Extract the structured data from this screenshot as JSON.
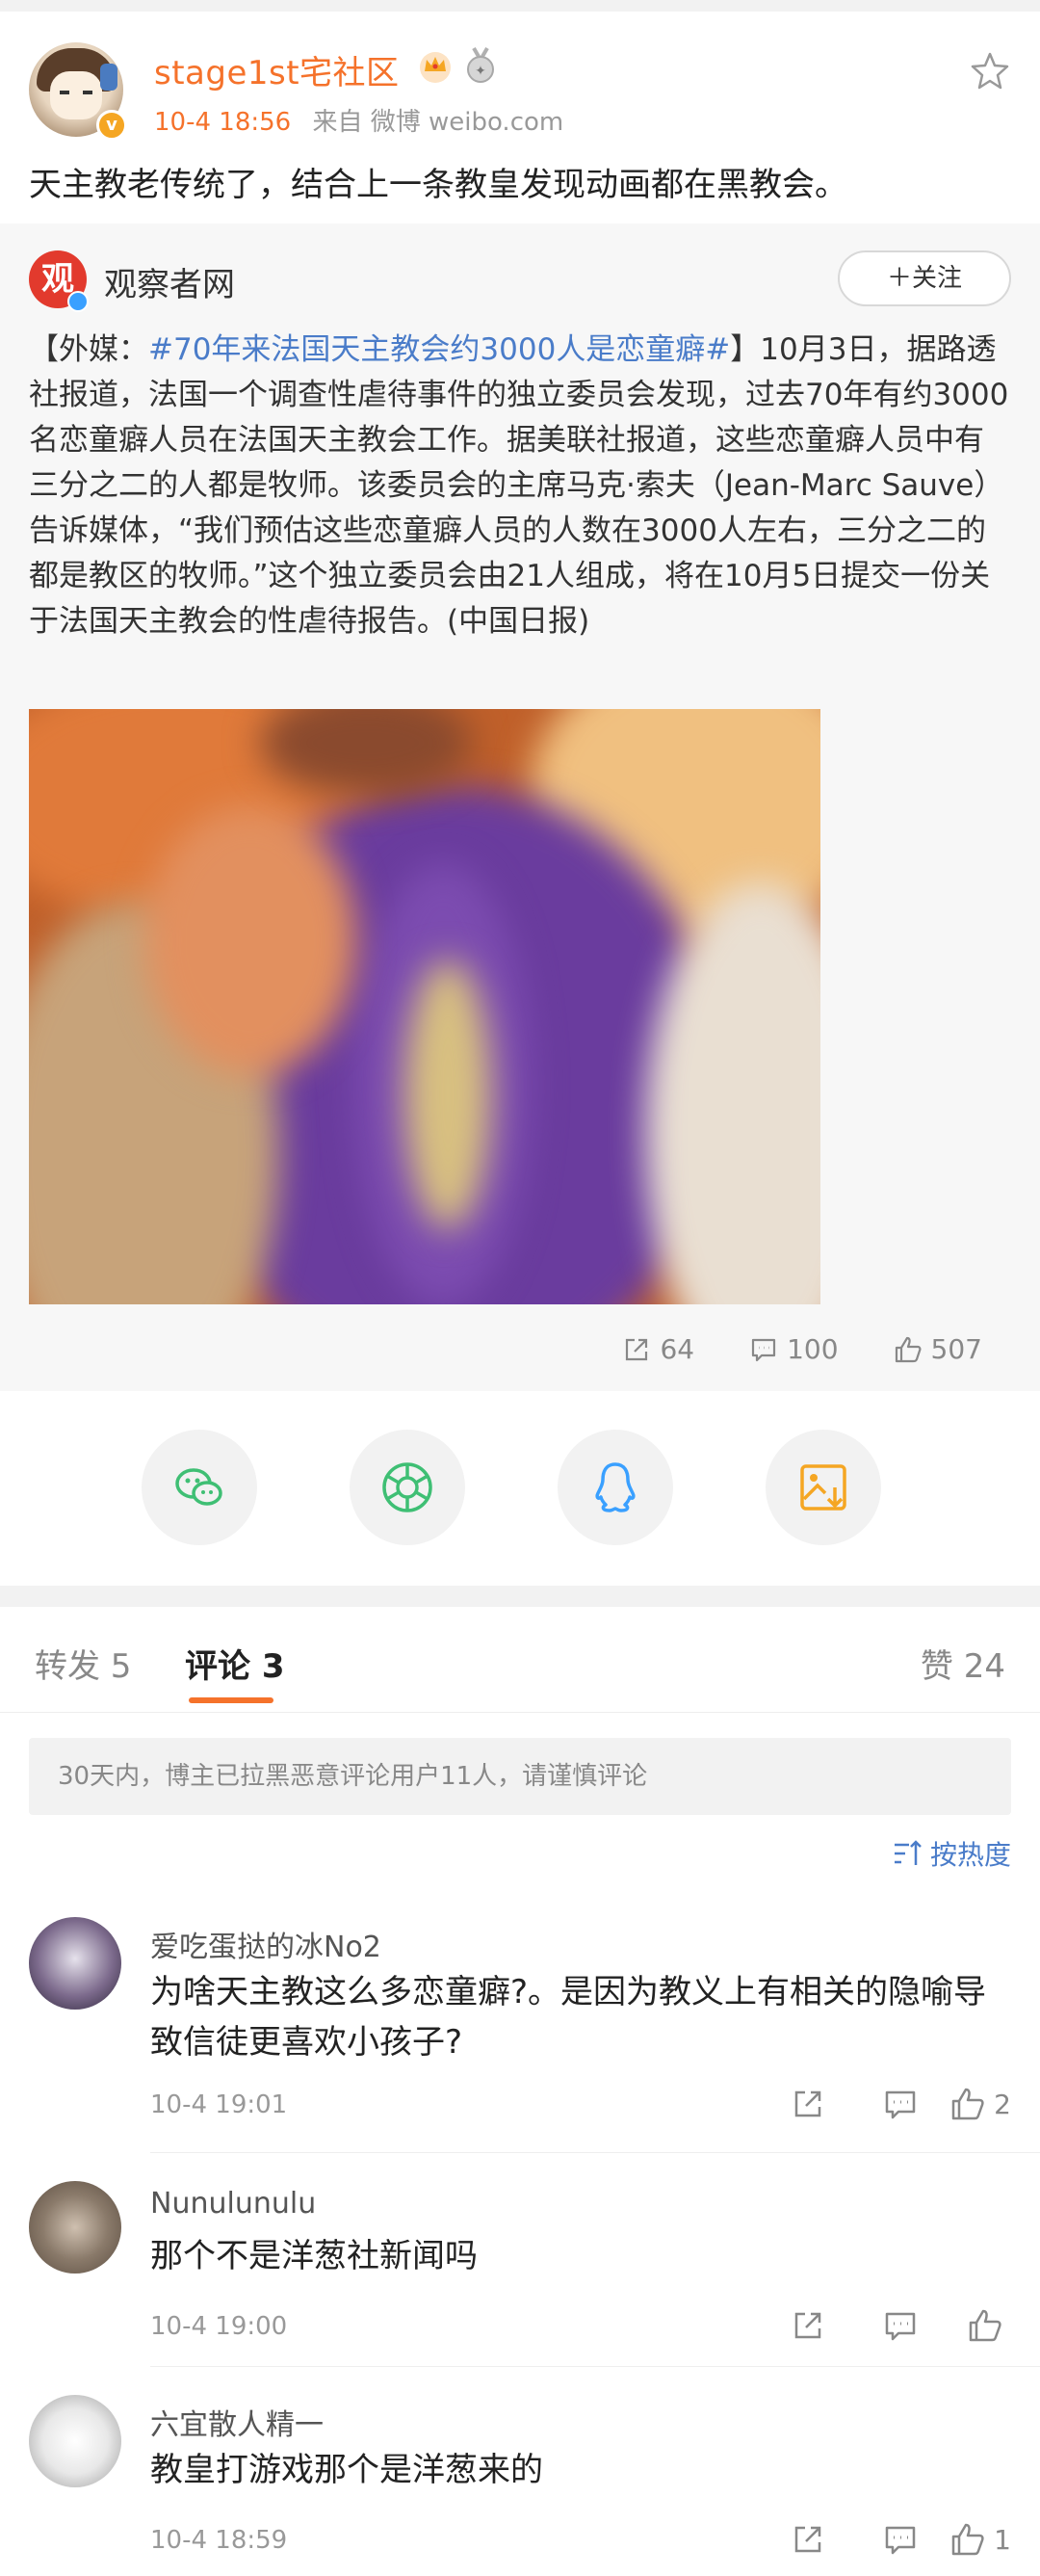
{
  "post": {
    "author": "stage1st宅社区",
    "time": "10-4 18:56",
    "source": "来自 微博 weibo.com",
    "text": "天主教老传统了，结合上一条教皇发现动画都在黑教会。"
  },
  "repost": {
    "source_name": "观察者网",
    "source_avatar_char": "观",
    "follow_label": "＋关注",
    "text_prefix": "【外媒：",
    "hashtag": "#70年来法国天主教会约3000人是恋童癖#",
    "text_body": "】10月3日，据路透社报道，法国一个调查性虐待事件的独立委员会发现，过去70年有约3000名恋童癖人员在法国天主教会工作。据美联社报道，这些恋童癖人员中有三分之二的人都是牧师。该委员会的主席马克·索夫（Jean-Marc Sauve）告诉媒体，“我们预估这些恋童癖人员的人数在3000人左右，三分之二的都是教区的牧师。”这个独立委员会由21人组成，将在10月5日提交一份关于法国天主教会的性虐待报告。(中国日报)",
    "stats": {
      "reposts": "64",
      "comments": "100",
      "likes": "507"
    }
  },
  "share": [
    "wechat-icon",
    "moments-icon",
    "qq-icon",
    "save-image-icon"
  ],
  "tabs": {
    "repost": "转发 5",
    "comment": "评论 3",
    "like": "赞 24"
  },
  "notice": "30天内，博主已拉黑恶意评论用户11人，请谨慎评论",
  "sort_label": "按热度",
  "comments": [
    {
      "name": "爱吃蛋挞的冰No2",
      "text": "为啥天主教这么多恋童癖?。是因为教义上有相关的隐喻导致信徒更喜欢小孩子?",
      "time": "10-4 19:01",
      "likes": "2"
    },
    {
      "name": "Nunulunulu",
      "text": "那个不是洋葱社新闻吗",
      "time": "10-4 19:00",
      "likes": ""
    },
    {
      "name": "六宜散人精一",
      "text": "教皇打游戏那个是洋葱来的",
      "time": "10-4 18:59",
      "likes": "1"
    }
  ],
  "colors": {
    "accent": "#f5722b",
    "link": "#4a7cc9",
    "wechat": "#3fbf74",
    "qq": "#3aa0ff",
    "save": "#f5a623"
  }
}
